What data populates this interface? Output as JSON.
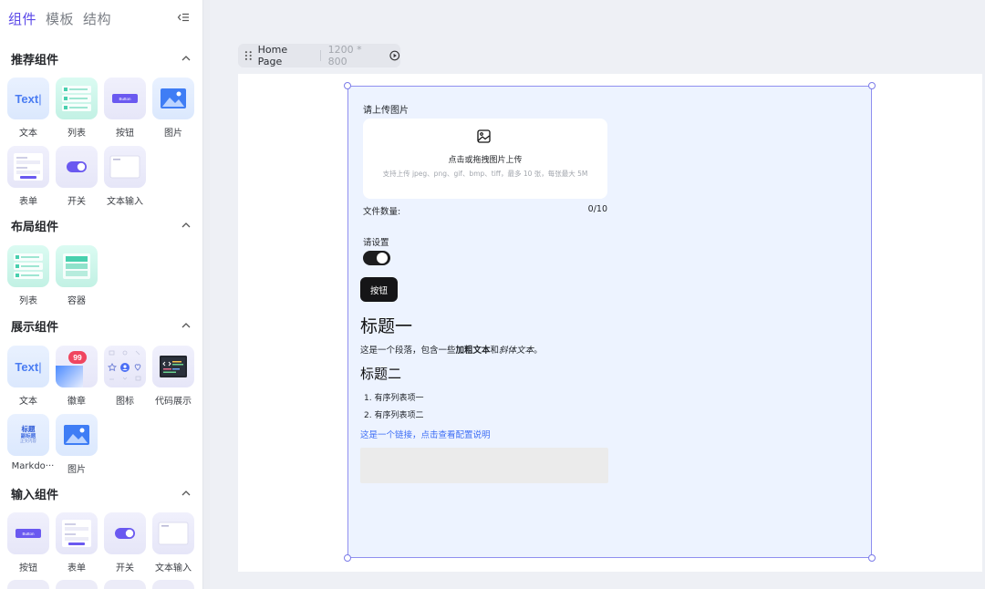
{
  "sidebar": {
    "tabs": [
      {
        "label": "组件",
        "active": true
      },
      {
        "label": "模板",
        "active": false
      },
      {
        "label": "结构",
        "active": false
      }
    ],
    "sections": [
      {
        "title": "推荐组件",
        "items": [
          {
            "label": "文本",
            "thumb_text": "Text"
          },
          {
            "label": "列表"
          },
          {
            "label": "按钮",
            "thumb_text": "Button"
          },
          {
            "label": "图片"
          },
          {
            "label": "表单"
          },
          {
            "label": "开关"
          },
          {
            "label": "文本输入"
          }
        ]
      },
      {
        "title": "布局组件",
        "items": [
          {
            "label": "列表"
          },
          {
            "label": "容器"
          }
        ]
      },
      {
        "title": "展示组件",
        "items": [
          {
            "label": "文本",
            "thumb_text": "Text"
          },
          {
            "label": "徽章",
            "badge": "99"
          },
          {
            "label": "图标"
          },
          {
            "label": "代码展示"
          },
          {
            "label": "Markdo···",
            "thumb_lines": [
              "标题",
              "副标题",
              "正文内容"
            ]
          },
          {
            "label": "图片"
          }
        ]
      },
      {
        "title": "输入组件",
        "items": [
          {
            "label": "按钮",
            "thumb_text": "Button"
          },
          {
            "label": "表单"
          },
          {
            "label": "开关"
          },
          {
            "label": "文本输入"
          }
        ]
      }
    ]
  },
  "frame": {
    "name": "Home Page",
    "size": "1200 * 800"
  },
  "page": {
    "upload_label": "请上传图片",
    "upload_title": "点击或拖拽图片上传",
    "upload_hint": "支持上传 jpeg、png、gif、bmp、tiff，最多 10 张，每张最大 5M",
    "file_count_label": "文件数量:",
    "file_count_value": "0/10",
    "setting_label": "请设置",
    "toggle_on": true,
    "button_label": "按钮",
    "heading1": "标题一",
    "paragraph": {
      "prefix": "这是一个段落，包含一些",
      "bold": "加粗文本",
      "middle": "和",
      "italic": "斜体文本",
      "suffix": "。"
    },
    "heading2": "标题二",
    "ordered_list": [
      "1. 有序列表项一",
      "2. 有序列表项二"
    ],
    "link_text": "这是一个链接，点击查看配置说明"
  },
  "colors": {
    "accent": "#5b49e8",
    "link": "#3d6ef5",
    "page_bg": "#edf3ff",
    "selection": "#8f8ff0"
  }
}
